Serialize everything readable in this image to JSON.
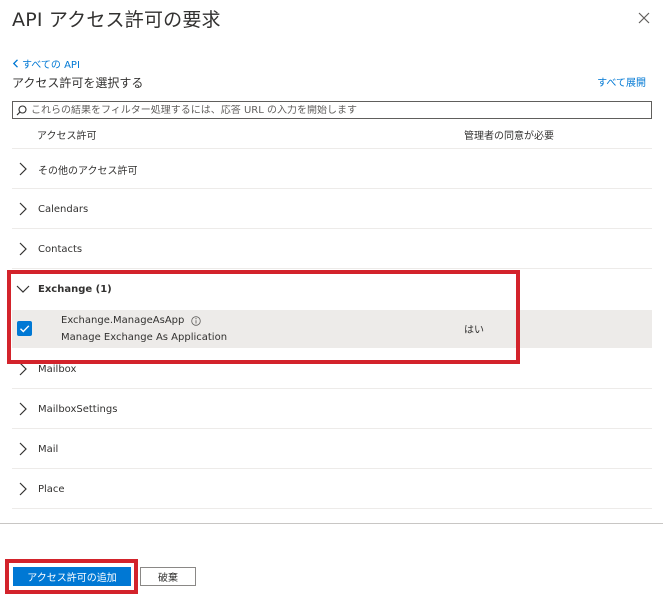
{
  "header": {
    "title": "API アクセス許可の要求",
    "close_icon": "close-icon"
  },
  "nav": {
    "back_label": "すべての API",
    "select_label": "アクセス許可を選択する",
    "expand_all": "すべて展開"
  },
  "search": {
    "placeholder": "これらの結果をフィルター処理するには、応答 URL の入力を開始します",
    "value": ""
  },
  "table": {
    "col_permission": "アクセス許可",
    "col_admin_consent": "管理者の同意が必要",
    "groups": [
      {
        "label": "その他のアクセス許可",
        "expanded": false
      },
      {
        "label": "Calendars",
        "expanded": false
      },
      {
        "label": "Contacts",
        "expanded": false
      },
      {
        "label": "Exchange (1)",
        "expanded": true
      },
      {
        "label": "Mailbox",
        "expanded": false
      },
      {
        "label": "MailboxSettings",
        "expanded": false
      },
      {
        "label": "Mail",
        "expanded": false
      },
      {
        "label": "Place",
        "expanded": false
      }
    ],
    "permission": {
      "name": "Exchange.ManageAsApp",
      "description": "Manage Exchange As Application",
      "admin_consent": "はい",
      "checked": true
    }
  },
  "footer": {
    "add_button": "アクセス許可の追加",
    "discard_button": "破棄"
  },
  "colors": {
    "accent": "#0078d4",
    "highlight": "#d3232b",
    "selected_row": "#edebe9"
  }
}
